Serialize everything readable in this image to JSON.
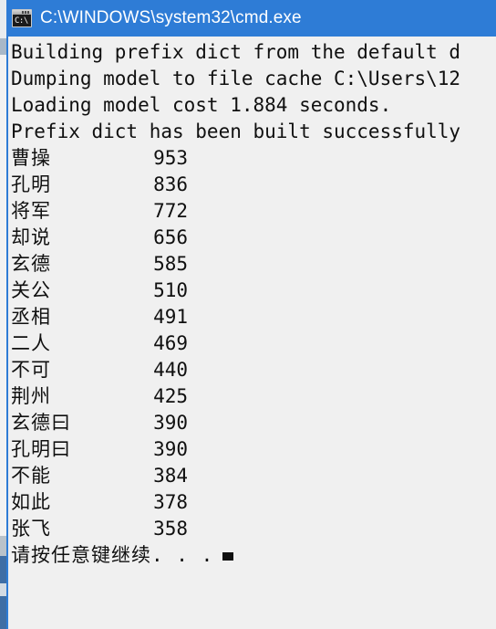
{
  "window": {
    "title": "C:\\WINDOWS\\system32\\cmd.exe",
    "icon": "cmd-icon",
    "icon_prompt_text": "C:\\",
    "titlebar_color": "#2e7cd6",
    "console_bg": "#f0f0f0",
    "console_fg": "#101010"
  },
  "console": {
    "log_lines": [
      "Building prefix dict from the default d",
      "Dumping model to file cache C:\\Users\\12",
      "Loading model cost 1.884 seconds.",
      "Prefix dict has been built successfully"
    ],
    "table": [
      {
        "word": "曹操",
        "count": "953"
      },
      {
        "word": "孔明",
        "count": "836"
      },
      {
        "word": "将军",
        "count": "772"
      },
      {
        "word": "却说",
        "count": "656"
      },
      {
        "word": "玄德",
        "count": "585"
      },
      {
        "word": "关公",
        "count": "510"
      },
      {
        "word": "丞相",
        "count": "491"
      },
      {
        "word": "二人",
        "count": "469"
      },
      {
        "word": "不可",
        "count": "440"
      },
      {
        "word": "荆州",
        "count": "425"
      },
      {
        "word": "玄德曰",
        "count": "390"
      },
      {
        "word": "孔明曰",
        "count": "390"
      },
      {
        "word": "不能",
        "count": "384"
      },
      {
        "word": "如此",
        "count": "378"
      },
      {
        "word": "张飞",
        "count": "358"
      }
    ],
    "prompt": "请按任意键继续. . .",
    "cursor": "block-cursor"
  }
}
